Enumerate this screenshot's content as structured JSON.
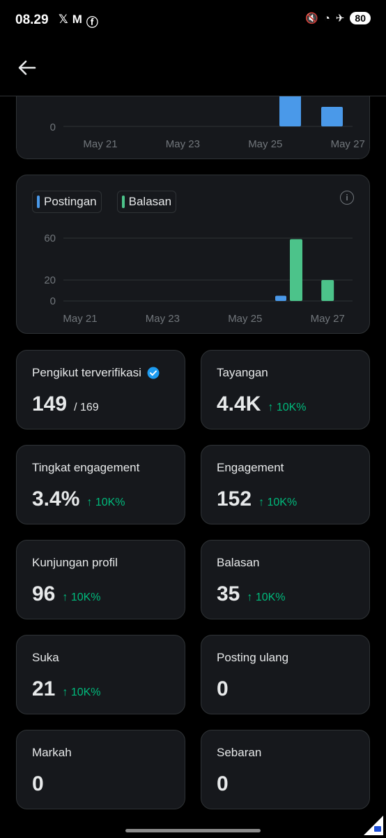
{
  "status": {
    "time": "08.29",
    "left_icons": [
      "x-icon",
      "gmail-icon",
      "facebook-icon"
    ],
    "battery": "80"
  },
  "colors": {
    "postingan": "#4a99e9",
    "balasan": "#4cc38a",
    "change": "#00ba7c"
  },
  "chart_data": [
    {
      "type": "bar",
      "partial": true,
      "x_ticks": [
        "May 21",
        "May 23",
        "May 25",
        "May 27"
      ],
      "y_ticks": [
        "0"
      ],
      "series": [
        {
          "name": "",
          "bars": [
            {
              "x_pos": 26.4,
              "value": "tall"
            },
            {
              "x_pos": 27.4,
              "value": "short"
            }
          ]
        }
      ]
    },
    {
      "type": "bar",
      "x_ticks": [
        "May 21",
        "May 23",
        "May 25",
        "May 27"
      ],
      "y_ticks": [
        "60",
        "20",
        "0"
      ],
      "legend": [
        "Postingan",
        "Balasan"
      ],
      "series": [
        {
          "name": "Postingan",
          "x": [
            "May 26"
          ],
          "values": [
            5
          ]
        },
        {
          "name": "Balasan",
          "x": [
            "May 26",
            "May 27"
          ],
          "values": [
            59,
            20
          ]
        }
      ]
    }
  ],
  "legend": {
    "postingan": "Postingan",
    "balasan": "Balasan"
  },
  "stats": [
    {
      "label": "Pengikut terverifikasi",
      "value": "149",
      "suffix": "/ 169",
      "change": "",
      "verified": true
    },
    {
      "label": "Tayangan",
      "value": "4.4K",
      "suffix": "",
      "change": "↑ 10K%"
    },
    {
      "label": "Tingkat engagement",
      "value": "3.4%",
      "suffix": "",
      "change": "↑ 10K%"
    },
    {
      "label": "Engagement",
      "value": "152",
      "suffix": "",
      "change": "↑ 10K%"
    },
    {
      "label": "Kunjungan profil",
      "value": "96",
      "suffix": "",
      "change": "↑ 10K%"
    },
    {
      "label": "Balasan",
      "value": "35",
      "suffix": "",
      "change": "↑ 10K%"
    },
    {
      "label": "Suka",
      "value": "21",
      "suffix": "",
      "change": "↑ 10K%"
    },
    {
      "label": "Posting ulang",
      "value": "0",
      "suffix": "",
      "change": ""
    },
    {
      "label": "Markah",
      "value": "0",
      "suffix": "",
      "change": ""
    },
    {
      "label": "Sebaran",
      "value": "0",
      "suffix": "",
      "change": ""
    }
  ]
}
